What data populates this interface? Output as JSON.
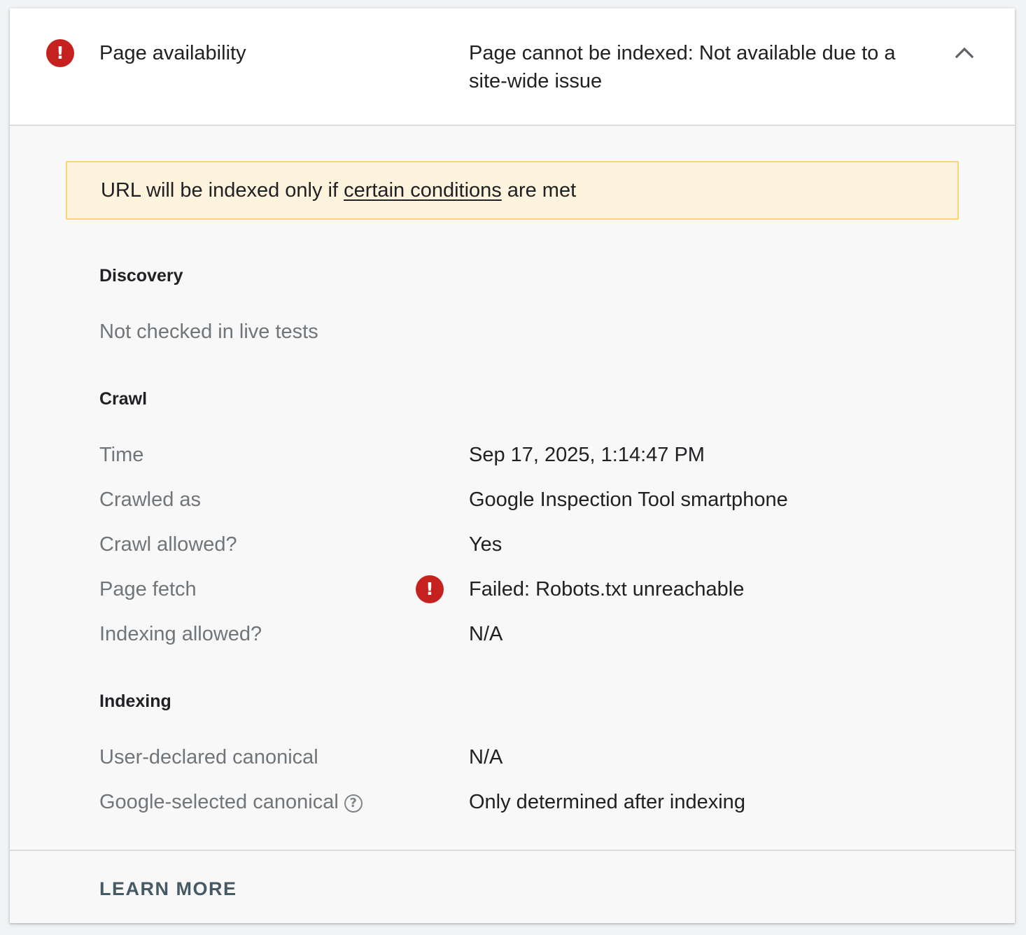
{
  "header": {
    "label": "Page availability",
    "status": "Page cannot be indexed: Not available due to a site-wide issue",
    "status_icon": "error-icon",
    "expand_icon": "chevron-up-icon"
  },
  "banner": {
    "prefix": "URL will be indexed only if ",
    "link": "certain conditions",
    "suffix": " are met"
  },
  "discovery": {
    "title": "Discovery",
    "note": "Not checked in live tests"
  },
  "crawl": {
    "title": "Crawl",
    "rows": [
      {
        "label": "Time",
        "value": "Sep 17, 2025, 1:14:47 PM"
      },
      {
        "label": "Crawled as",
        "value": "Google Inspection Tool smartphone"
      },
      {
        "label": "Crawl allowed?",
        "value": "Yes"
      },
      {
        "label": "Page fetch",
        "value": "Failed: Robots.txt unreachable",
        "icon": "error-icon"
      },
      {
        "label": "Indexing allowed?",
        "value": "N/A"
      }
    ]
  },
  "indexing": {
    "title": "Indexing",
    "rows": [
      {
        "label": "User-declared canonical",
        "value": "N/A"
      },
      {
        "label": "Google-selected canonical",
        "value": "Only determined after indexing",
        "help_icon": "help-icon"
      }
    ]
  },
  "footer": {
    "learn_more": "LEARN MORE"
  },
  "colors": {
    "error": "#c5221f",
    "banner_bg": "#fef3dc",
    "banner_border": "#f9d67a",
    "muted_text": "#70757a",
    "learn_more": "#455a64"
  }
}
